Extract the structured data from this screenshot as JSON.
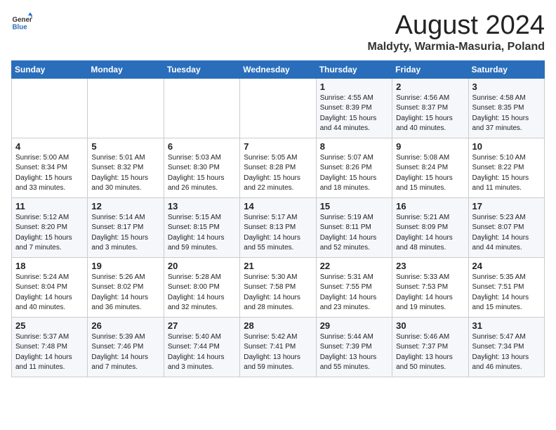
{
  "logo": {
    "general": "General",
    "blue": "Blue"
  },
  "title": "August 2024",
  "location": "Maldyty, Warmia-Masuria, Poland",
  "days_of_week": [
    "Sunday",
    "Monday",
    "Tuesday",
    "Wednesday",
    "Thursday",
    "Friday",
    "Saturday"
  ],
  "weeks": [
    [
      {
        "day": "",
        "info": ""
      },
      {
        "day": "",
        "info": ""
      },
      {
        "day": "",
        "info": ""
      },
      {
        "day": "",
        "info": ""
      },
      {
        "day": "1",
        "info": "Sunrise: 4:55 AM\nSunset: 8:39 PM\nDaylight: 15 hours\nand 44 minutes."
      },
      {
        "day": "2",
        "info": "Sunrise: 4:56 AM\nSunset: 8:37 PM\nDaylight: 15 hours\nand 40 minutes."
      },
      {
        "day": "3",
        "info": "Sunrise: 4:58 AM\nSunset: 8:35 PM\nDaylight: 15 hours\nand 37 minutes."
      }
    ],
    [
      {
        "day": "4",
        "info": "Sunrise: 5:00 AM\nSunset: 8:34 PM\nDaylight: 15 hours\nand 33 minutes."
      },
      {
        "day": "5",
        "info": "Sunrise: 5:01 AM\nSunset: 8:32 PM\nDaylight: 15 hours\nand 30 minutes."
      },
      {
        "day": "6",
        "info": "Sunrise: 5:03 AM\nSunset: 8:30 PM\nDaylight: 15 hours\nand 26 minutes."
      },
      {
        "day": "7",
        "info": "Sunrise: 5:05 AM\nSunset: 8:28 PM\nDaylight: 15 hours\nand 22 minutes."
      },
      {
        "day": "8",
        "info": "Sunrise: 5:07 AM\nSunset: 8:26 PM\nDaylight: 15 hours\nand 18 minutes."
      },
      {
        "day": "9",
        "info": "Sunrise: 5:08 AM\nSunset: 8:24 PM\nDaylight: 15 hours\nand 15 minutes."
      },
      {
        "day": "10",
        "info": "Sunrise: 5:10 AM\nSunset: 8:22 PM\nDaylight: 15 hours\nand 11 minutes."
      }
    ],
    [
      {
        "day": "11",
        "info": "Sunrise: 5:12 AM\nSunset: 8:20 PM\nDaylight: 15 hours\nand 7 minutes."
      },
      {
        "day": "12",
        "info": "Sunrise: 5:14 AM\nSunset: 8:17 PM\nDaylight: 15 hours\nand 3 minutes."
      },
      {
        "day": "13",
        "info": "Sunrise: 5:15 AM\nSunset: 8:15 PM\nDaylight: 14 hours\nand 59 minutes."
      },
      {
        "day": "14",
        "info": "Sunrise: 5:17 AM\nSunset: 8:13 PM\nDaylight: 14 hours\nand 55 minutes."
      },
      {
        "day": "15",
        "info": "Sunrise: 5:19 AM\nSunset: 8:11 PM\nDaylight: 14 hours\nand 52 minutes."
      },
      {
        "day": "16",
        "info": "Sunrise: 5:21 AM\nSunset: 8:09 PM\nDaylight: 14 hours\nand 48 minutes."
      },
      {
        "day": "17",
        "info": "Sunrise: 5:23 AM\nSunset: 8:07 PM\nDaylight: 14 hours\nand 44 minutes."
      }
    ],
    [
      {
        "day": "18",
        "info": "Sunrise: 5:24 AM\nSunset: 8:04 PM\nDaylight: 14 hours\nand 40 minutes."
      },
      {
        "day": "19",
        "info": "Sunrise: 5:26 AM\nSunset: 8:02 PM\nDaylight: 14 hours\nand 36 minutes."
      },
      {
        "day": "20",
        "info": "Sunrise: 5:28 AM\nSunset: 8:00 PM\nDaylight: 14 hours\nand 32 minutes."
      },
      {
        "day": "21",
        "info": "Sunrise: 5:30 AM\nSunset: 7:58 PM\nDaylight: 14 hours\nand 28 minutes."
      },
      {
        "day": "22",
        "info": "Sunrise: 5:31 AM\nSunset: 7:55 PM\nDaylight: 14 hours\nand 23 minutes."
      },
      {
        "day": "23",
        "info": "Sunrise: 5:33 AM\nSunset: 7:53 PM\nDaylight: 14 hours\nand 19 minutes."
      },
      {
        "day": "24",
        "info": "Sunrise: 5:35 AM\nSunset: 7:51 PM\nDaylight: 14 hours\nand 15 minutes."
      }
    ],
    [
      {
        "day": "25",
        "info": "Sunrise: 5:37 AM\nSunset: 7:48 PM\nDaylight: 14 hours\nand 11 minutes."
      },
      {
        "day": "26",
        "info": "Sunrise: 5:39 AM\nSunset: 7:46 PM\nDaylight: 14 hours\nand 7 minutes."
      },
      {
        "day": "27",
        "info": "Sunrise: 5:40 AM\nSunset: 7:44 PM\nDaylight: 14 hours\nand 3 minutes."
      },
      {
        "day": "28",
        "info": "Sunrise: 5:42 AM\nSunset: 7:41 PM\nDaylight: 13 hours\nand 59 minutes."
      },
      {
        "day": "29",
        "info": "Sunrise: 5:44 AM\nSunset: 7:39 PM\nDaylight: 13 hours\nand 55 minutes."
      },
      {
        "day": "30",
        "info": "Sunrise: 5:46 AM\nSunset: 7:37 PM\nDaylight: 13 hours\nand 50 minutes."
      },
      {
        "day": "31",
        "info": "Sunrise: 5:47 AM\nSunset: 7:34 PM\nDaylight: 13 hours\nand 46 minutes."
      }
    ]
  ]
}
